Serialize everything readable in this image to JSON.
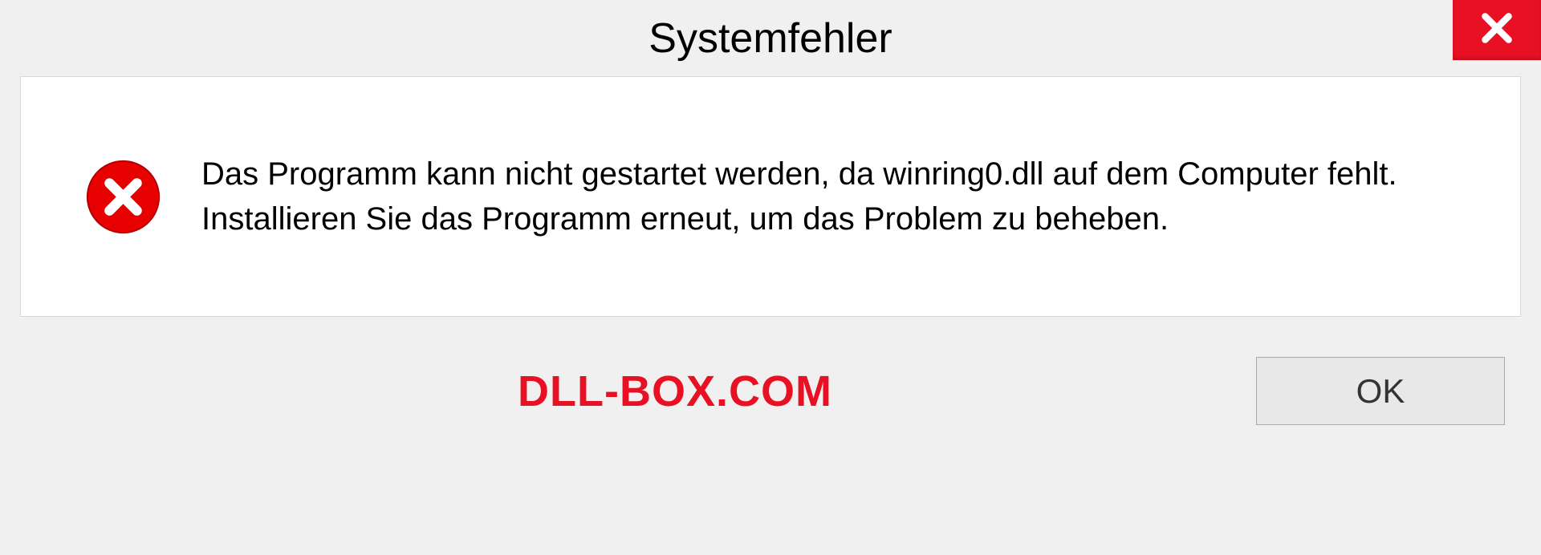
{
  "dialog": {
    "title": "Systemfehler",
    "message": "Das Programm kann nicht gestartet werden, da winring0.dll auf dem Computer fehlt. Installieren Sie das Programm erneut, um das Problem zu beheben.",
    "ok_label": "OK"
  },
  "watermark": "DLL-BOX.COM"
}
